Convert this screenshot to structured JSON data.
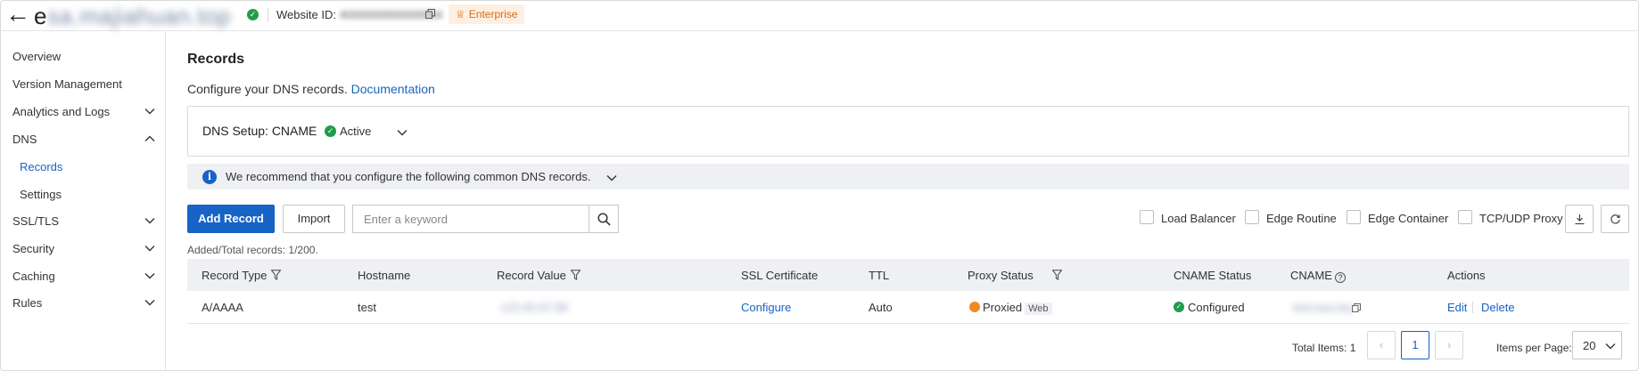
{
  "header": {
    "site_name_prefix": "e",
    "site_name_rest": "sa.majiahuan.top",
    "website_id_label": "Website ID: ",
    "website_id_value": "4000000000000004",
    "plan_badge": "Enterprise"
  },
  "sidebar": {
    "items": [
      {
        "label": "Overview"
      },
      {
        "label": "Version Management"
      },
      {
        "label": "Analytics and Logs"
      },
      {
        "label": "DNS"
      },
      {
        "label": "Records"
      },
      {
        "label": "Settings"
      },
      {
        "label": "SSL/TLS"
      },
      {
        "label": "Security"
      },
      {
        "label": "Caching"
      },
      {
        "label": "Rules"
      }
    ]
  },
  "main": {
    "title": "Records",
    "description": "Configure your DNS records. ",
    "doc_link": "Documentation",
    "dns_setup_label": "DNS Setup: CNAME",
    "dns_setup_status": "Active",
    "tip_text": "We recommend that you configure the following common DNS records.",
    "add_button": "Add Record",
    "import_button": "Import",
    "search_placeholder": "Enter a keyword",
    "filters": [
      "Load Balancer",
      "Edge Routine",
      "Edge Container",
      "TCP/UDP Proxy"
    ],
    "count_text": "Added/Total records: 1/200."
  },
  "table": {
    "columns": [
      "Record Type",
      "Hostname",
      "Record Value",
      "SSL Certificate",
      "TTL",
      "Proxy Status",
      "CNAME Status",
      "CNAME",
      "Actions"
    ],
    "rows": [
      {
        "record_type": "A/AAAA",
        "hostname": "test",
        "record_value": "123.45.67.89",
        "ssl": "Configure",
        "ttl": "Auto",
        "proxy_status": "Proxied",
        "proxy_tag": "Web",
        "cname_status": "Configured",
        "cname": "test.esa.top",
        "action_edit": "Edit",
        "action_delete": "Delete"
      }
    ]
  },
  "pagination": {
    "total_items": "Total Items: 1",
    "current_page": "1",
    "per_page_label": "Items per Page:",
    "per_page_value": "20"
  },
  "colors": {
    "accent": "#1763c6",
    "success": "#1f9d4a",
    "enterprise": "#d86a12",
    "proxy": "#f08a24"
  }
}
